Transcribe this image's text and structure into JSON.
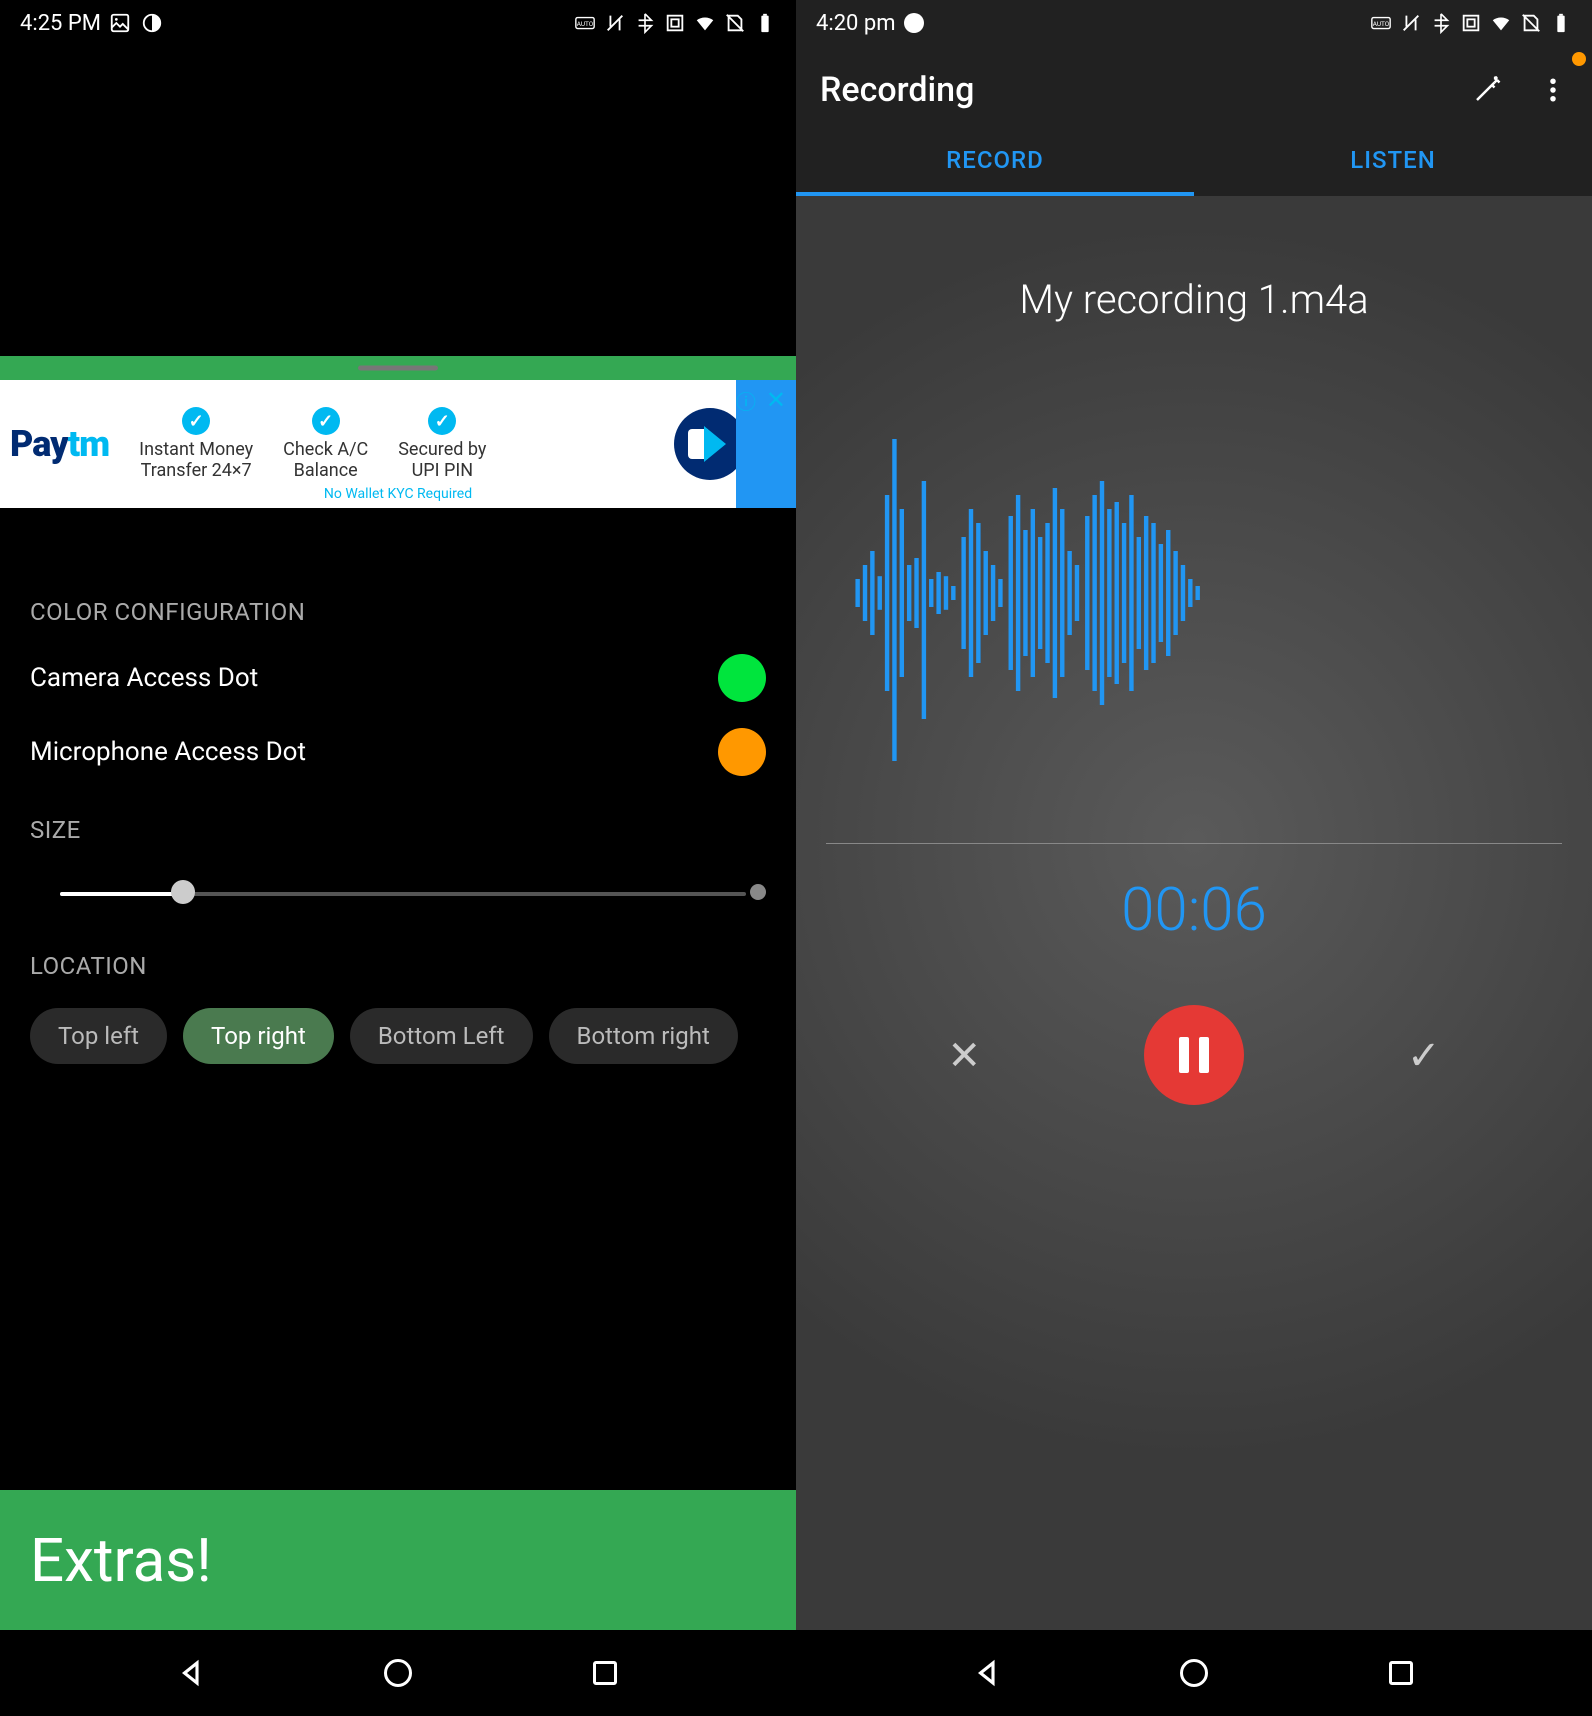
{
  "left": {
    "statusbar": {
      "time": "4:25 PM"
    },
    "ad": {
      "logo_a": "Pay",
      "logo_b": "tm",
      "col1_l1": "Instant Money",
      "col1_l2": "Transfer 24×7",
      "col2_l1": "Check A/C",
      "col2_l2": "Balance",
      "col3_l1": "Secured by",
      "col3_l2": "UPI PIN",
      "kyc": "No Wallet KYC Required",
      "info": "ⓘ",
      "close": "✕"
    },
    "sections": {
      "color_title": "COLOR CONFIGURATION",
      "camera_label": "Camera Access Dot",
      "mic_label": "Microphone Access Dot",
      "size_title": "SIZE",
      "location_title": "LOCATION",
      "chips": [
        "Top left",
        "Top right",
        "Bottom Left",
        "Bottom right"
      ],
      "chip_active_index": 1
    },
    "extras": "Extras!"
  },
  "right": {
    "statusbar": {
      "time": "4:20 pm"
    },
    "appbar": {
      "title": "Recording",
      "tab_record": "RECORD",
      "tab_listen": "LISTEN"
    },
    "filename": "My recording 1.m4a",
    "time": "00:06",
    "controls": {
      "cancel": "✕",
      "confirm": "✓"
    }
  },
  "colors": {
    "brand_green": "#34a853",
    "access_green": "#00e53d",
    "access_orange": "#ff9800",
    "rec_blue": "#2196f3",
    "rec_red": "#e53935"
  }
}
